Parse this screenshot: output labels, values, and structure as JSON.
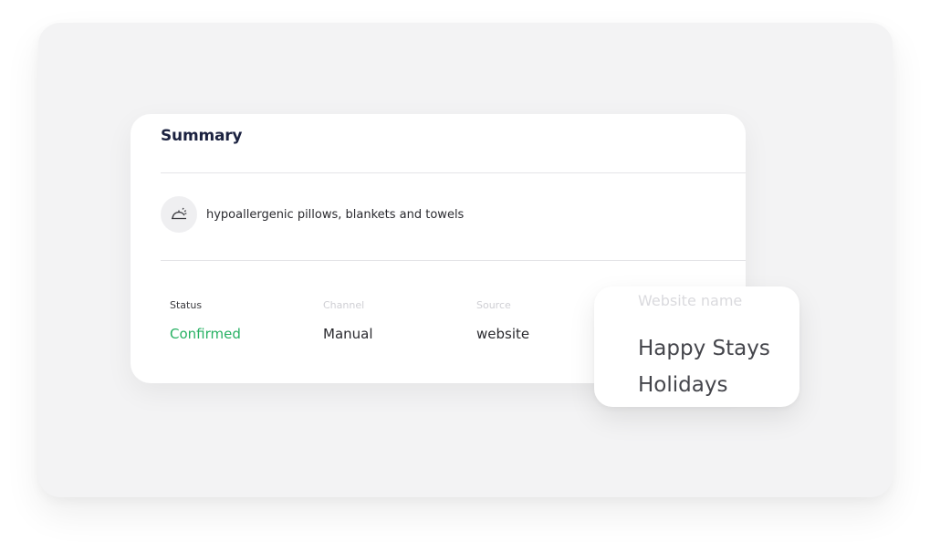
{
  "summary": {
    "title": "Summary",
    "amenity": {
      "icon": "service-bell-icon",
      "label": "hypoallergenic pillows, blankets and towels"
    },
    "status": {
      "label": "Status",
      "value": "Confirmed"
    },
    "channel": {
      "label": "Channel",
      "value": "Manual"
    },
    "source": {
      "label": "Source",
      "value": "website"
    }
  },
  "website": {
    "label": "Website name",
    "value": "Happy Stays Holidays"
  },
  "colors": {
    "status_confirmed": "#27b163",
    "title": "#1b2240",
    "background": "#f3f3f4"
  }
}
